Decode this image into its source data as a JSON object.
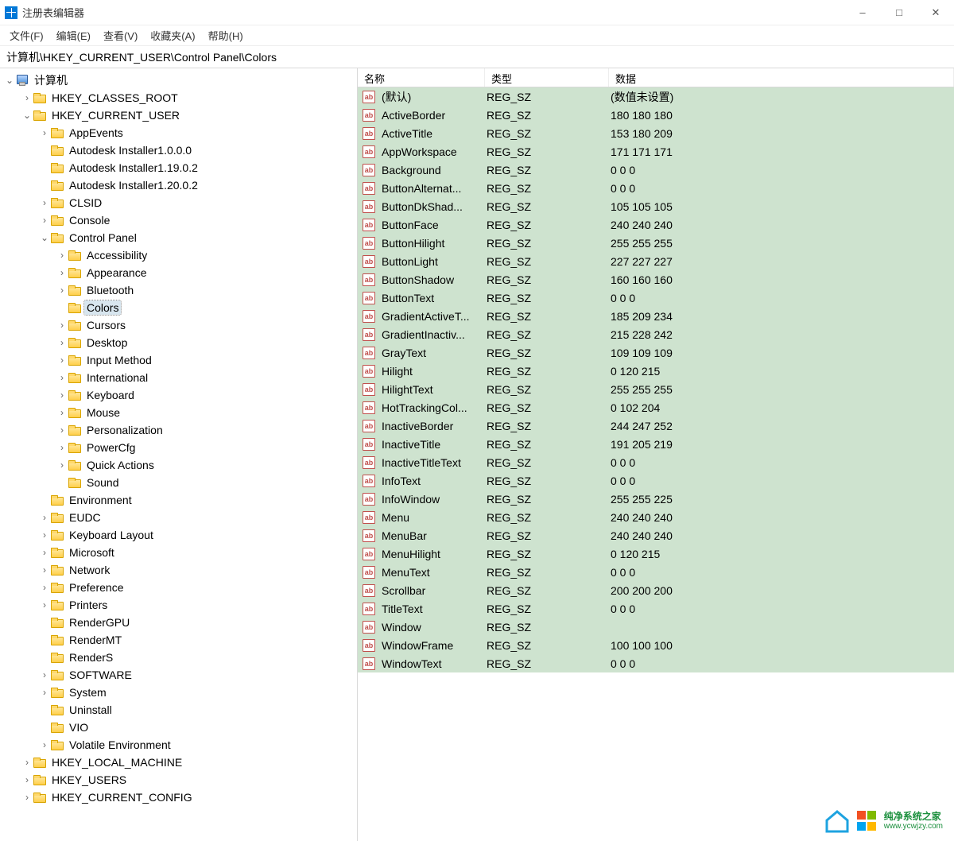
{
  "window": {
    "title": "注册表编辑器"
  },
  "menu": {
    "file": "文件(F)",
    "edit": "编辑(E)",
    "view": "查看(V)",
    "favorites": "收藏夹(A)",
    "help": "帮助(H)"
  },
  "address": "计算机\\HKEY_CURRENT_USER\\Control Panel\\Colors",
  "tree": {
    "root": "计算机",
    "hives": {
      "hkcr": "HKEY_CLASSES_ROOT",
      "hkcu": "HKEY_CURRENT_USER",
      "hklm": "HKEY_LOCAL_MACHINE",
      "hku": "HKEY_USERS",
      "hkcc": "HKEY_CURRENT_CONFIG"
    },
    "hkcu_children": [
      "AppEvents",
      "Autodesk Installer1.0.0.0",
      "Autodesk Installer1.19.0.2",
      "Autodesk Installer1.20.0.2",
      "CLSID",
      "Console",
      "Control Panel",
      "Environment",
      "EUDC",
      "Keyboard Layout",
      "Microsoft",
      "Network",
      "Preference",
      "Printers",
      "RenderGPU",
      "RenderMT",
      "RenderS",
      "SOFTWARE",
      "System",
      "Uninstall",
      "VIO",
      "Volatile Environment"
    ],
    "control_panel_children": [
      "Accessibility",
      "Appearance",
      "Bluetooth",
      "Colors",
      "Cursors",
      "Desktop",
      "Input Method",
      "International",
      "Keyboard",
      "Mouse",
      "Personalization",
      "PowerCfg",
      "Quick Actions",
      "Sound"
    ],
    "selected": "Colors"
  },
  "columns": {
    "name": "名称",
    "type": "类型",
    "data": "数据"
  },
  "values": [
    {
      "name": "(默认)",
      "type": "REG_SZ",
      "data": "(数值未设置)"
    },
    {
      "name": "ActiveBorder",
      "type": "REG_SZ",
      "data": "180 180 180"
    },
    {
      "name": "ActiveTitle",
      "type": "REG_SZ",
      "data": "153 180 209"
    },
    {
      "name": "AppWorkspace",
      "type": "REG_SZ",
      "data": "171 171 171"
    },
    {
      "name": "Background",
      "type": "REG_SZ",
      "data": "0 0 0"
    },
    {
      "name": "ButtonAlternat...",
      "type": "REG_SZ",
      "data": "0 0 0"
    },
    {
      "name": "ButtonDkShad...",
      "type": "REG_SZ",
      "data": "105 105 105"
    },
    {
      "name": "ButtonFace",
      "type": "REG_SZ",
      "data": "240 240 240"
    },
    {
      "name": "ButtonHilight",
      "type": "REG_SZ",
      "data": "255 255 255"
    },
    {
      "name": "ButtonLight",
      "type": "REG_SZ",
      "data": "227 227 227"
    },
    {
      "name": "ButtonShadow",
      "type": "REG_SZ",
      "data": "160 160 160"
    },
    {
      "name": "ButtonText",
      "type": "REG_SZ",
      "data": "0 0 0"
    },
    {
      "name": "GradientActiveT...",
      "type": "REG_SZ",
      "data": "185 209 234"
    },
    {
      "name": "GradientInactiv...",
      "type": "REG_SZ",
      "data": "215 228 242"
    },
    {
      "name": "GrayText",
      "type": "REG_SZ",
      "data": "109 109 109"
    },
    {
      "name": "Hilight",
      "type": "REG_SZ",
      "data": "0 120 215"
    },
    {
      "name": "HilightText",
      "type": "REG_SZ",
      "data": "255 255 255"
    },
    {
      "name": "HotTrackingCol...",
      "type": "REG_SZ",
      "data": "0 102 204"
    },
    {
      "name": "InactiveBorder",
      "type": "REG_SZ",
      "data": "244 247 252"
    },
    {
      "name": "InactiveTitle",
      "type": "REG_SZ",
      "data": "191 205 219"
    },
    {
      "name": "InactiveTitleText",
      "type": "REG_SZ",
      "data": "0 0 0"
    },
    {
      "name": "InfoText",
      "type": "REG_SZ",
      "data": "0 0 0"
    },
    {
      "name": "InfoWindow",
      "type": "REG_SZ",
      "data": "255 255 225"
    },
    {
      "name": "Menu",
      "type": "REG_SZ",
      "data": "240 240 240"
    },
    {
      "name": "MenuBar",
      "type": "REG_SZ",
      "data": "240 240 240"
    },
    {
      "name": "MenuHilight",
      "type": "REG_SZ",
      "data": "0 120 215"
    },
    {
      "name": "MenuText",
      "type": "REG_SZ",
      "data": "0 0 0"
    },
    {
      "name": "Scrollbar",
      "type": "REG_SZ",
      "data": "200 200 200"
    },
    {
      "name": "TitleText",
      "type": "REG_SZ",
      "data": "0 0 0"
    },
    {
      "name": "Window",
      "type": "REG_SZ",
      "data": ""
    },
    {
      "name": "WindowFrame",
      "type": "REG_SZ",
      "data": "100 100 100"
    },
    {
      "name": "WindowText",
      "type": "REG_SZ",
      "data": "0 0 0"
    }
  ],
  "watermark": {
    "line1": "纯净系统之家",
    "line2": "www.ycwjzy.com"
  }
}
